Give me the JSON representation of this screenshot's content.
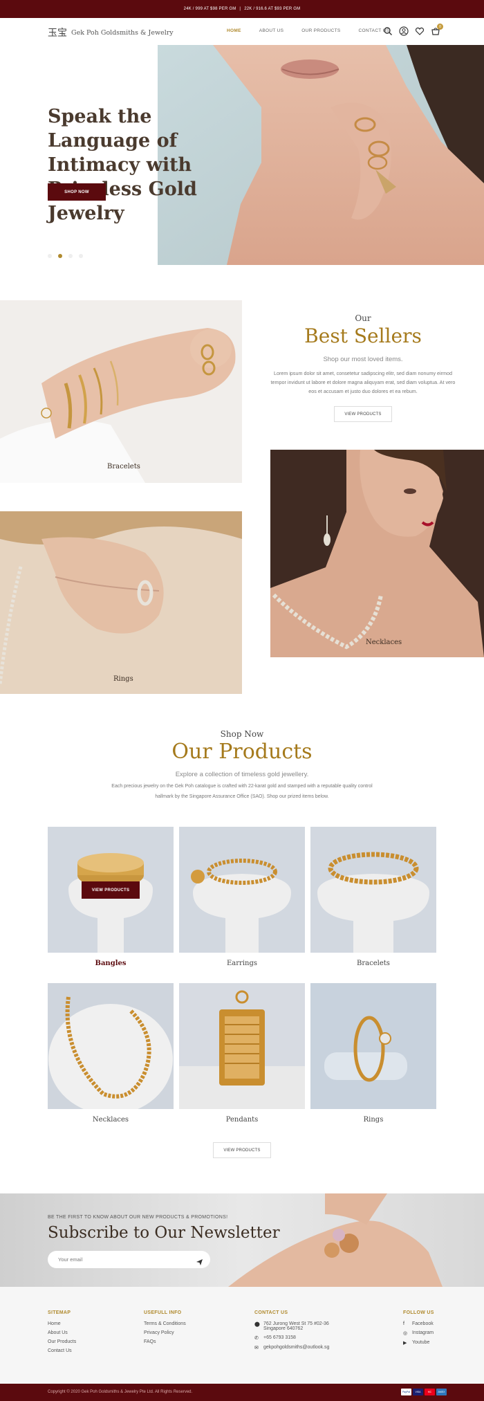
{
  "topbar": {
    "gold24": "24K / 999 AT $98 PER GM",
    "separator": "|",
    "gold22": "22K / 916.6 AT $93 PER GM"
  },
  "header": {
    "logo_glyph": "玉宝",
    "logo_text": "Gek Poh Goldsmiths & Jewelry",
    "nav": [
      {
        "label": "HOME",
        "active": true
      },
      {
        "label": "ABOUT US",
        "active": false
      },
      {
        "label": "OUR PRODUCTS",
        "active": false
      },
      {
        "label": "CONTACT US",
        "active": false
      }
    ],
    "cart_count": "0",
    "icons": [
      "search-icon",
      "user-icon",
      "heart-icon",
      "cart-icon"
    ]
  },
  "hero": {
    "title": "Speak the Language of Intimacy with Priceless Gold Jewelry",
    "button": "SHOP NOW",
    "active_slide": 2,
    "slide_count": 4
  },
  "best_sellers": {
    "pre": "Our",
    "title": "Best Sellers",
    "subtitle": "Shop our most loved items.",
    "text": "Lorem ipsum dolor sit amet, consetetur sadipscing elitr, sed diam nonumy eirmod tempor invidunt ut labore et dolore magna aliquyam erat, sed diam voluptua. At vero eos et accusam et justo duo dolores et ea rebum.",
    "button": "VIEW PRODUCTS",
    "tiles": {
      "bracelets": "Bracelets",
      "necklaces": "Necklaces",
      "rings": "Rings"
    }
  },
  "products": {
    "pre": "Shop Now",
    "title": "Our Products",
    "subtitle": "Explore a collection of timeless gold jewellery.",
    "desc1": "Each precious jewelry on the Gek Poh catalogue is crafted with 22-karat gold and stamped with a reputable quality control",
    "desc2": "hallmark by the Singapore Assurance Office (SAO). Shop our prized items below.",
    "overlay_button": "VIEW PRODUCTS",
    "items": [
      "Bangles",
      "Earrings",
      "Bracelets",
      "Necklaces",
      "Pendants",
      "Rings"
    ],
    "button": "VIEW PRODUCTS"
  },
  "newsletter": {
    "pre": "BE THE FIRST TO KNOW ABOUT OUR NEW PRODUCTS & PROMOTIONS!",
    "title": "Subscribe to Our Newsletter",
    "placeholder": "Your email"
  },
  "footer": {
    "sitemap": {
      "title": "SITEMAP",
      "links": [
        "Home",
        "About Us",
        "Our Products",
        "Contact Us"
      ]
    },
    "info": {
      "title": "USEFULL INFO",
      "links": [
        "Terms & Conditions",
        "Privacy Policy",
        "FAQs"
      ]
    },
    "contact": {
      "title": "CONTACT US",
      "address1": "762 Jurong West St 75 #02-36",
      "address2": "Singapore 640762",
      "phone": "+65 6793 3158",
      "email": "gekpohgoldsmiths@outlook.sg"
    },
    "follow": {
      "title": "FOLLOW US",
      "links": [
        "Facebook",
        "Instagram",
        "Youtube"
      ]
    },
    "copyright": "Copyright © 2020 Gek Poh Goldsmiths & Jewelry Pte Ltd. All Rights Reserved.",
    "payments": [
      "PayPal",
      "VISA",
      "MC",
      "AMEX"
    ]
  },
  "colors": {
    "maroon": "#5b0a0e",
    "gold": "#a57a1c"
  }
}
